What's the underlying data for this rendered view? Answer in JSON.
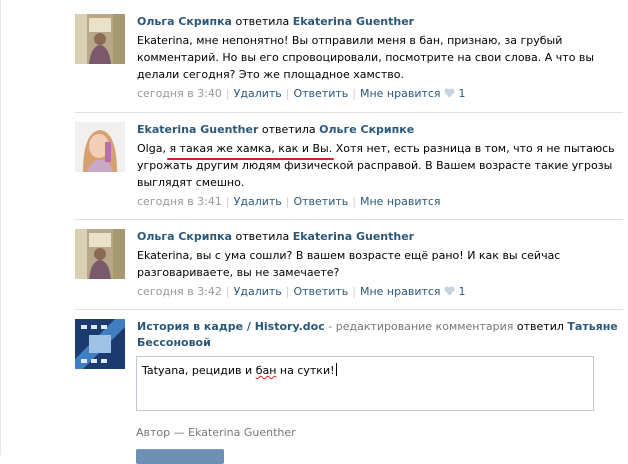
{
  "comments": [
    {
      "author": "Ольга Скрипка",
      "verb": "ответила",
      "recipient": "Ekaterina Guenther",
      "text": "Ekaterina, мне непонятно! Вы отправили меня в бан, признаю, за грубый комментарий. Но вы его спровоцировали, посмотрите на свои слова. А что вы делали сегодня? Это же площадное хамство.",
      "time": "сегодня в 3:40",
      "delete_label": "Удалить",
      "reply_label": "Ответить",
      "like_label": "Мне нравится",
      "likes": "1"
    },
    {
      "author": "Ekaterina Guenther",
      "verb": "ответила",
      "recipient": "Ольге Скрипке",
      "text_start": "Olga,",
      "text_highlight": "я такая же хамка, как и Вы.",
      "text_end": "Хотя нет, есть разница в том, что я не пытаюсь угрожать другим людям физической расправой. В Вашем возрасте такие угрозы выглядят смешно.",
      "time": "сегодня в 3:41",
      "delete_label": "Удалить",
      "reply_label": "Ответить",
      "like_label": "Мне нравится"
    },
    {
      "author": "Ольга Скрипка",
      "verb": "ответила",
      "recipient": "Ekaterina Guenther",
      "text": "Ekaterina, вы с ума сошли? В вашем возрасте ещё рано! И как вы сейчас разговариваете, вы не замечаете?",
      "time": "сегодня в 3:42",
      "delete_label": "Удалить",
      "reply_label": "Ответить",
      "like_label": "Мне нравится",
      "likes": "1"
    }
  ],
  "reply": {
    "author": "История в кадре / History.doc",
    "mode_text": "- редактирование комментария",
    "verb": "ответил",
    "recipient": "Татьяне Бессоновой",
    "text_before": "Tatyana, рецидив и",
    "text_spell": "бан",
    "text_after": "на сутки!",
    "byline": "Автор — Ekaterina Guenther"
  },
  "colors": {
    "link": "#2b587a",
    "separator": "#dae1e8",
    "highlight_underline": "#d2232a",
    "button": "#6d8fb3"
  }
}
